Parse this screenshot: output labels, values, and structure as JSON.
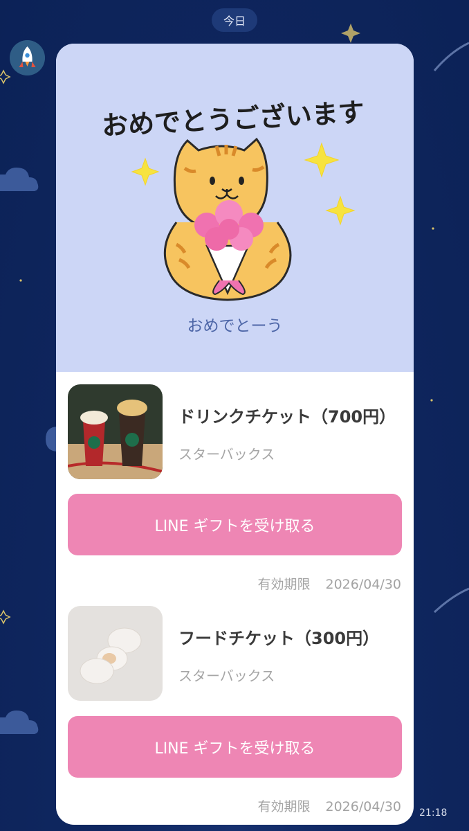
{
  "date_divider": "今日",
  "message": {
    "sticker_text": "おめでとうございます",
    "caption": "おめでとーう",
    "time": "21:18"
  },
  "gifts": [
    {
      "title": "ドリンクチケット（700円）",
      "brand": "スターバックス",
      "button_label": "LINE ギフトを受け取る",
      "expiry_label": "有効期限",
      "expiry_date": "2026/04/30",
      "thumb": "starbucks-drinks-image"
    },
    {
      "title": "フードチケット（300円）",
      "brand": "スターバックス",
      "button_label": "LINE ギフトを受け取る",
      "expiry_label": "有効期限",
      "expiry_date": "2026/04/30",
      "thumb": "sugar-donut-image"
    }
  ],
  "colors": {
    "background": "#0f2760",
    "hero": "#ccd6f6",
    "button": "#ee86b4",
    "caption": "#4e67a8"
  }
}
